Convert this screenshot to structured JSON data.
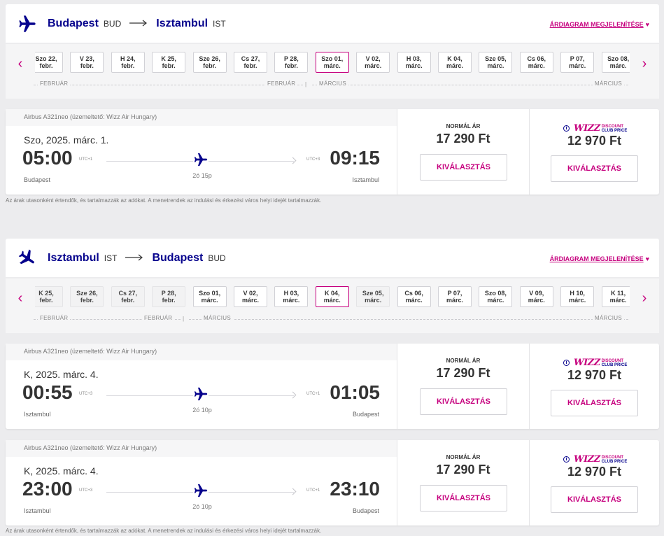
{
  "diagram_label": "ÁRDIAGRAM MEGJELENÍTÉSE",
  "labels": {
    "normal_price": "NORMÁL ÁR",
    "select": "KIVÁLASZTÁS",
    "discount_logo": "WIZZ",
    "discount_line1": "DISCOUNT",
    "discount_line2": "CLUB PRICE"
  },
  "note": "Az árak utasonként értendők, és tartalmazzák az adókat. A menetrendek az indulási és érkezési város helyi idejét tartalmazzák.",
  "colors": {
    "brand_blue": "#06038d",
    "brand_pink": "#c6007e"
  },
  "outbound": {
    "from_city": "Budapest",
    "from_code": "BUD",
    "to_city": "Isztambul",
    "to_code": "IST",
    "dates": [
      {
        "l1": "Szo 22,",
        "l2": "febr.",
        "state": "normal"
      },
      {
        "l1": "V 23,",
        "l2": "febr.",
        "state": "normal"
      },
      {
        "l1": "H 24,",
        "l2": "febr.",
        "state": "normal"
      },
      {
        "l1": "K 25,",
        "l2": "febr.",
        "state": "normal"
      },
      {
        "l1": "Sze 26,",
        "l2": "febr.",
        "state": "normal"
      },
      {
        "l1": "Cs 27,",
        "l2": "febr.",
        "state": "normal"
      },
      {
        "l1": "P 28,",
        "l2": "febr.",
        "state": "normal"
      },
      {
        "l1": "Szo 01,",
        "l2": "márc.",
        "state": "selected"
      },
      {
        "l1": "V 02,",
        "l2": "márc.",
        "state": "normal"
      },
      {
        "l1": "H 03,",
        "l2": "márc.",
        "state": "normal"
      },
      {
        "l1": "K 04,",
        "l2": "márc.",
        "state": "normal"
      },
      {
        "l1": "Sze 05,",
        "l2": "márc.",
        "state": "normal"
      },
      {
        "l1": "Cs 06,",
        "l2": "márc.",
        "state": "normal"
      },
      {
        "l1": "P 07,",
        "l2": "márc.",
        "state": "normal"
      },
      {
        "l1": "Szo 08,",
        "l2": "márc.",
        "state": "normal"
      }
    ],
    "months": [
      "FEBRUÁR",
      "FEBRUÁR",
      "MÁRCIUS",
      "MÁRCIUS"
    ],
    "flights": [
      {
        "aircraft": "Airbus A321neo (üzemeltető: Wizz Air Hungary)",
        "date": "Szo, 2025. márc. 1.",
        "dep_time": "05:00",
        "dep_tz": "UTC+1",
        "dep_city": "Budapest",
        "arr_time": "09:15",
        "arr_tz": "UTC+3",
        "arr_city": "Isztambul",
        "duration": "2ó 15p",
        "normal_price": "17 290 Ft",
        "club_price": "12 970 Ft"
      }
    ]
  },
  "inbound": {
    "from_city": "Isztambul",
    "from_code": "IST",
    "to_city": "Budapest",
    "to_code": "BUD",
    "dates": [
      {
        "l1": "K 25,",
        "l2": "febr.",
        "state": "disabled"
      },
      {
        "l1": "Sze 26,",
        "l2": "febr.",
        "state": "disabled"
      },
      {
        "l1": "Cs 27,",
        "l2": "febr.",
        "state": "disabled"
      },
      {
        "l1": "P 28,",
        "l2": "febr.",
        "state": "disabled"
      },
      {
        "l1": "Szo 01,",
        "l2": "márc.",
        "state": "normal"
      },
      {
        "l1": "V 02,",
        "l2": "márc.",
        "state": "normal"
      },
      {
        "l1": "H 03,",
        "l2": "márc.",
        "state": "normal"
      },
      {
        "l1": "K 04,",
        "l2": "márc.",
        "state": "selected"
      },
      {
        "l1": "Sze 05,",
        "l2": "márc.",
        "state": "disabled"
      },
      {
        "l1": "Cs 06,",
        "l2": "márc.",
        "state": "normal"
      },
      {
        "l1": "P 07,",
        "l2": "márc.",
        "state": "normal"
      },
      {
        "l1": "Szo 08,",
        "l2": "márc.",
        "state": "normal"
      },
      {
        "l1": "V 09,",
        "l2": "márc.",
        "state": "normal"
      },
      {
        "l1": "H 10,",
        "l2": "márc.",
        "state": "normal"
      },
      {
        "l1": "K 11,",
        "l2": "márc.",
        "state": "normal"
      }
    ],
    "months": [
      "FEBRUÁR",
      "FEBRUÁR",
      "MÁRCIUS",
      "MÁRCIUS"
    ],
    "flights": [
      {
        "aircraft": "Airbus A321neo (üzemeltető: Wizz Air Hungary)",
        "date": "K, 2025. márc. 4.",
        "dep_time": "00:55",
        "dep_tz": "UTC+3",
        "dep_city": "Isztambul",
        "arr_time": "01:05",
        "arr_tz": "UTC+1",
        "arr_city": "Budapest",
        "duration": "2ó 10p",
        "normal_price": "17 290 Ft",
        "club_price": "12 970 Ft"
      },
      {
        "aircraft": "Airbus A321neo (üzemeltető: Wizz Air Hungary)",
        "date": "K, 2025. márc. 4.",
        "dep_time": "23:00",
        "dep_tz": "UTC+3",
        "dep_city": "Isztambul",
        "arr_time": "23:10",
        "arr_tz": "UTC+1",
        "arr_city": "Budapest",
        "duration": "2ó 10p",
        "normal_price": "17 290 Ft",
        "club_price": "12 970 Ft"
      }
    ]
  }
}
